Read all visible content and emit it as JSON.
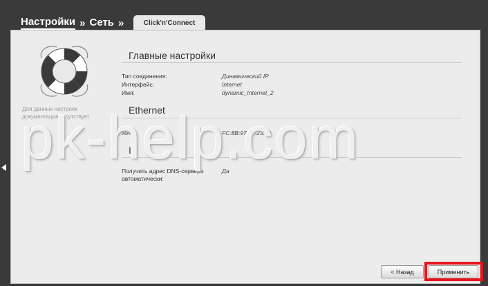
{
  "breadcrumb": {
    "item1": "Настройки",
    "sep1": "»",
    "item2": "Сеть",
    "sep2": "»"
  },
  "tab": {
    "label": "Click'n'Connect"
  },
  "sidebar": {
    "doc_note_line1": "Для данных настроек",
    "doc_note_line2": "документация отсутствует",
    "help_icon": "lifebuoy-icon"
  },
  "sections": {
    "main": {
      "title": "Главные настройки",
      "rows": [
        {
          "label": "Тип соединения:",
          "value": "Динамический IP"
        },
        {
          "label": "Интерфейс:",
          "value": "Internet"
        },
        {
          "label": "Имя:",
          "value": "dynamic_Internet_2"
        }
      ]
    },
    "ethernet": {
      "title": "Ethernet",
      "rows": [
        {
          "label": "MAC:",
          "value": "FC:8B:97:59:23:49"
        }
      ]
    },
    "ip": {
      "title": "IP",
      "rows": [
        {
          "label": "Получить адрес DNS-сервера автоматически:",
          "value": "Да"
        }
      ]
    }
  },
  "watermark": "pk-help.com",
  "buttons": {
    "back": "< Назад",
    "apply": "Применить"
  },
  "colors": {
    "highlight": "#e8141b",
    "frame": "#3a3a3a",
    "panel": "#ececec"
  }
}
